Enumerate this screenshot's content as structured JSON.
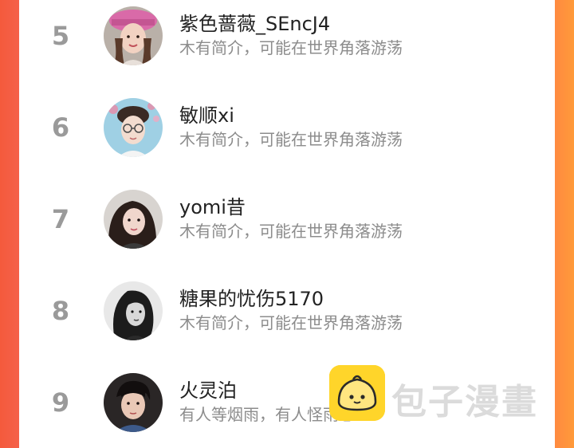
{
  "list": {
    "items": [
      {
        "rank": "5",
        "name": "紫色蔷薇_SEncJ4",
        "bio": "木有简介，可能在世界角落游荡",
        "avatar_icon": "avatar-pink-hat-woman"
      },
      {
        "rank": "6",
        "name": "敏顺xi",
        "bio": "木有简介，可能在世界角落游荡",
        "avatar_icon": "avatar-boy-glasses"
      },
      {
        "rank": "7",
        "name": "yomi昔",
        "bio": "木有简介，可能在世界角落游荡",
        "avatar_icon": "avatar-girl-dark-hair"
      },
      {
        "rank": "8",
        "name": "糖果的忧伤5170",
        "bio": "木有简介，可能在世界角落游荡",
        "avatar_icon": "avatar-bw-woman"
      },
      {
        "rank": "9",
        "name": "火灵泊",
        "bio": "有人等烟雨，有人怪雨急",
        "avatar_icon": "avatar-young-man"
      }
    ]
  },
  "watermark": {
    "text": "包子漫畫",
    "logo_icon": "bun-mascot-icon"
  },
  "colors": {
    "accent_left": "#f45a3c",
    "accent_right": "#ff9a3a",
    "rank_gray": "#9a9a9a",
    "logo_yellow": "#ffd52a"
  }
}
